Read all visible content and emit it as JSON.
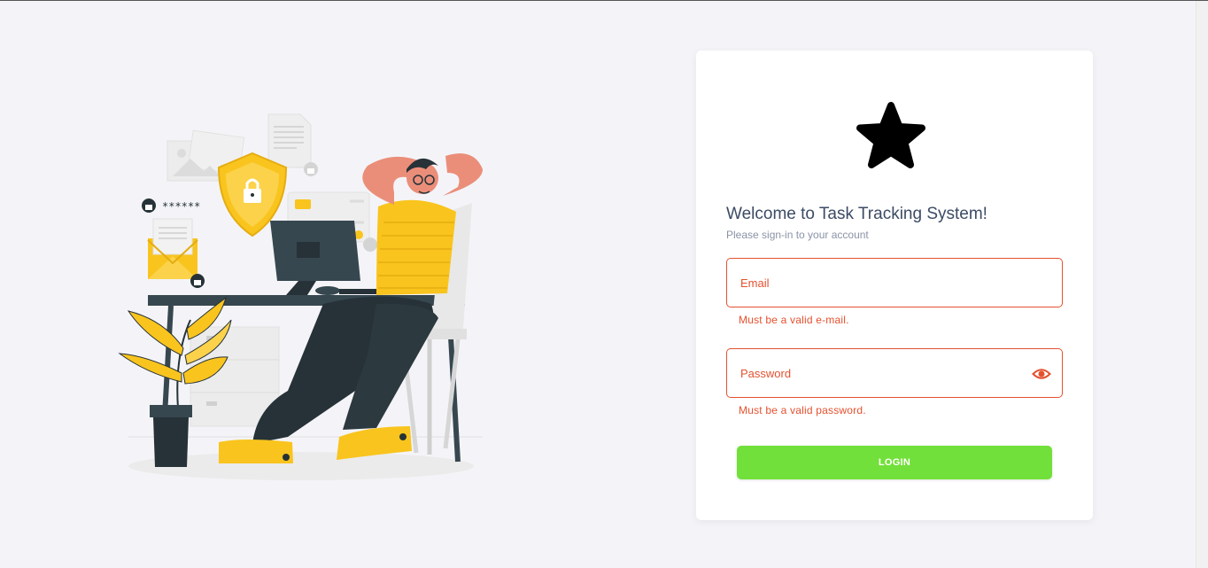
{
  "login": {
    "title": "Welcome to Task Tracking System!",
    "subtitle": "Please sign-in to your account",
    "email": {
      "placeholder": "Email",
      "value": "",
      "error": "Must be a valid e-mail."
    },
    "password": {
      "placeholder": "Password",
      "value": "",
      "error": "Must be a valid password.",
      "toggle_icon": "eye-icon"
    },
    "submit_label": "LOGIN",
    "logo_icon": "star-icon"
  },
  "illustration": {
    "masked_password": "******",
    "icons": [
      "shield-lock-icon",
      "padlock-icon",
      "envelope-icon",
      "document-icon",
      "image-icon",
      "monitor-icon",
      "plant-icon"
    ]
  },
  "colors": {
    "background": "#f4f4f8",
    "card": "#ffffff",
    "error": "#e4512f",
    "button": "#72e03a",
    "title": "#3c4b64",
    "accent_yellow": "#f9c41d",
    "dark": "#263238"
  }
}
